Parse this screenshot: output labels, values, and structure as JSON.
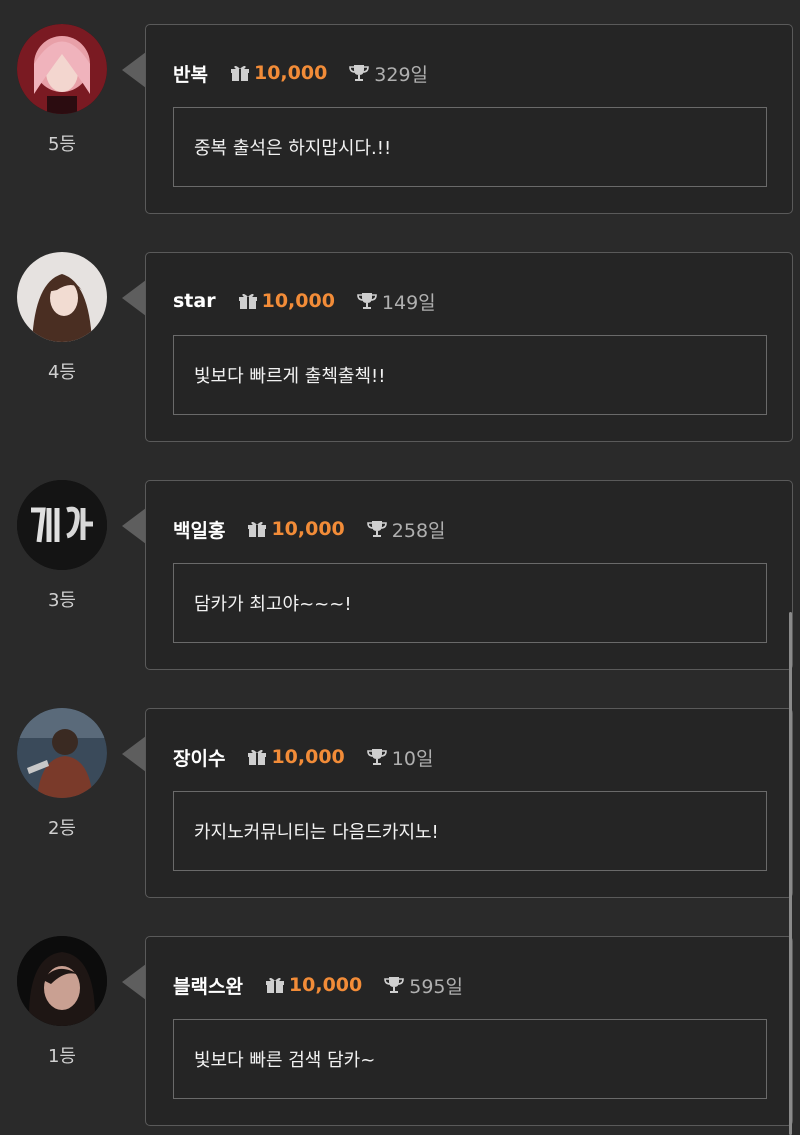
{
  "entries": [
    {
      "name": "반복",
      "points": "10,000",
      "days": "329일",
      "message": "중복 출석은 하지맙시다.!!",
      "rank": "5등",
      "avatar_icon": "avatar-photo-pink-hair"
    },
    {
      "name": "star",
      "points": "10,000",
      "days": "149일",
      "message": "빛보다 빠르게 출첵출첵!!",
      "rank": "4등",
      "avatar_icon": "avatar-photo-long-hair"
    },
    {
      "name": "백일홍",
      "points": "10,000",
      "days": "258일",
      "message": "담카가 최고야~~~!",
      "rank": "3등",
      "avatar_icon": "avatar-photo-neon-sign"
    },
    {
      "name": "장이수",
      "points": "10,000",
      "days": "10일",
      "message": "카지노커뮤니티는 다음드카지노!",
      "rank": "2등",
      "avatar_icon": "avatar-photo-man"
    },
    {
      "name": "블랙스완",
      "points": "10,000",
      "days": "595일",
      "message": "빛보다 빠른 검색 담카~",
      "rank": "1등",
      "avatar_icon": "avatar-photo-dark-portrait"
    }
  ],
  "icons": {
    "points": "gift-icon",
    "days": "trophy-icon"
  },
  "colors": {
    "background": "#2a2a2a",
    "points": "#f28c38",
    "border": "#5a5a5a"
  }
}
